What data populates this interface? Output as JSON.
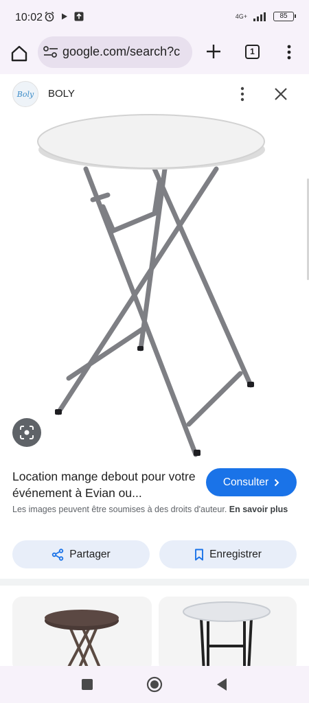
{
  "status_bar": {
    "time": "10:02",
    "network": "4G+",
    "battery": "85"
  },
  "browser": {
    "url": "google.com/search?c",
    "tab_count": "1"
  },
  "viewer": {
    "source_name": "BOLY",
    "source_logo_text": "Boly"
  },
  "result": {
    "title": "Location mange debout pour votre événement à Evian ou...",
    "consult_label": "Consulter",
    "copyright": "Les images peuvent être soumises à des droits d'auteur.",
    "learn_more": "En savoir plus"
  },
  "actions": {
    "share_label": "Partager",
    "save_label": "Enregistrer"
  },
  "colors": {
    "accent": "#1a73e8",
    "chrome_bg": "#f7f2fa",
    "action_bg": "#e8eef9"
  },
  "icons": [
    "alarm-icon",
    "play-icon",
    "upload-icon",
    "signal-icon",
    "battery-icon",
    "home-icon",
    "tune-icon",
    "plus-icon",
    "tabs-icon",
    "more-vert-icon",
    "close-icon",
    "lens-icon",
    "chevron-right-icon",
    "share-icon",
    "bookmark-icon",
    "recents-icon",
    "nav-home-icon",
    "back-icon"
  ]
}
